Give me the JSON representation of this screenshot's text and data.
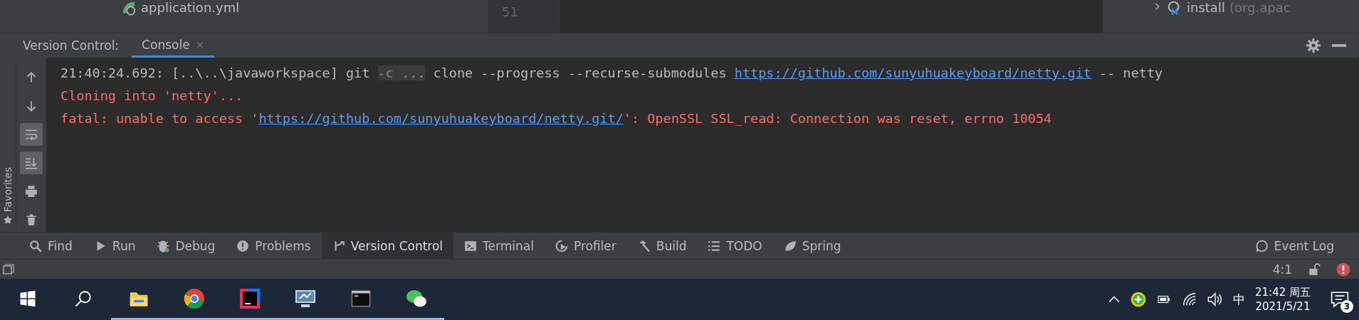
{
  "top": {
    "project_file": "application.yml",
    "line_number": "51",
    "maven_item": {
      "label": "install",
      "detail": "(org.apac"
    }
  },
  "tool_window": {
    "title": "Version Control:",
    "tabs": [
      {
        "label": "Console",
        "selected": true
      }
    ]
  },
  "gutter_buttons": [
    {
      "kind": "up",
      "on": false
    },
    {
      "kind": "down",
      "on": false
    },
    {
      "kind": "wrap",
      "on": true
    },
    {
      "kind": "scroll-end",
      "on": true
    },
    {
      "kind": "print",
      "on": false
    },
    {
      "kind": "trash",
      "on": false
    }
  ],
  "console": {
    "lines": [
      {
        "kind": "info",
        "segments": [
          {
            "kind": "plain",
            "text": "21:40:24.692: [..\\..\\javaworkspace] git "
          },
          {
            "kind": "folded",
            "text": "-c ..."
          },
          {
            "kind": "plain",
            "text": " clone --progress --recurse-submodules "
          },
          {
            "kind": "link",
            "text": "https://github.com/sunyuhuakeyboard/netty.git"
          },
          {
            "kind": "plain",
            "text": " -- netty"
          }
        ]
      },
      {
        "kind": "error",
        "segments": [
          {
            "kind": "plain",
            "text": "Cloning into 'netty'..."
          }
        ]
      },
      {
        "kind": "error",
        "segments": [
          {
            "kind": "plain",
            "text": "fatal: unable to access '"
          },
          {
            "kind": "link",
            "text": "https://github.com/sunyuhuakeyboard/netty.git/"
          },
          {
            "kind": "plain",
            "text": "': OpenSSL SSL_read: Connection was reset, errno 10054"
          }
        ]
      }
    ]
  },
  "favorites": {
    "label": "Favorites"
  },
  "bottom_tabs": [
    {
      "kind": "find",
      "label": "Find",
      "selected": false
    },
    {
      "kind": "run",
      "label": "Run",
      "selected": false
    },
    {
      "kind": "debug",
      "label": "Debug",
      "selected": false
    },
    {
      "kind": "problems",
      "label": "Problems",
      "selected": false
    },
    {
      "kind": "vcs",
      "label": "Version Control",
      "selected": true
    },
    {
      "kind": "terminal",
      "label": "Terminal",
      "selected": false
    },
    {
      "kind": "profiler",
      "label": "Profiler",
      "selected": false
    },
    {
      "kind": "build",
      "label": "Build",
      "selected": false
    },
    {
      "kind": "todo",
      "label": "TODO",
      "selected": false
    },
    {
      "kind": "spring",
      "label": "Spring",
      "selected": false
    }
  ],
  "event_log": {
    "label": "Event Log"
  },
  "status_bar": {
    "position": "4:1"
  },
  "taskbar": {
    "apps": [
      {
        "kind": "folder",
        "running": true
      },
      {
        "kind": "browser",
        "running": true
      },
      {
        "kind": "ide",
        "running": true
      },
      {
        "kind": "monitor",
        "running": true
      },
      {
        "kind": "terminal",
        "running": true
      },
      {
        "kind": "chat",
        "running": true
      }
    ],
    "ime": "中",
    "time": "21:42 周五",
    "date": "2021/5/21",
    "notifications": "3"
  }
}
